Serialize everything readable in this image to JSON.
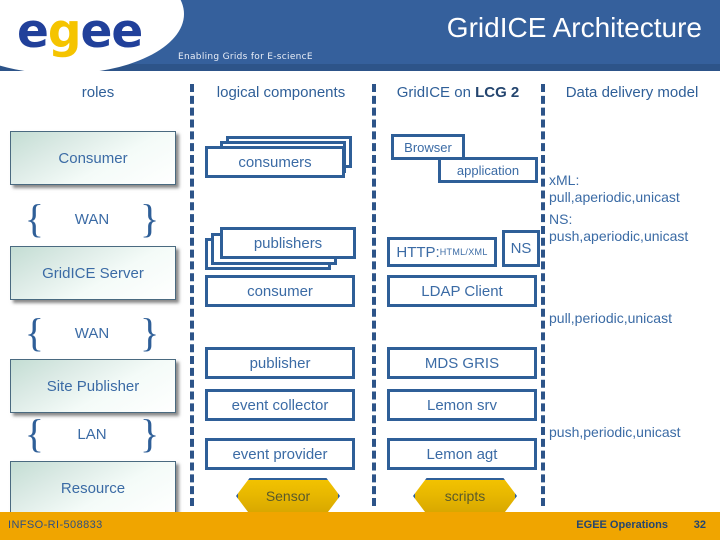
{
  "header": {
    "logo_text_1": "e",
    "logo_text_gold": "g",
    "logo_text_2": "ee",
    "tagline": "Enabling Grids for E-sciencE",
    "title": "GridICE Architecture",
    "band_color": "#35609c",
    "logo_blue": "#21409a",
    "logo_gold": "#f5c400"
  },
  "columns": [
    {
      "label": "roles"
    },
    {
      "label": "logical components"
    },
    {
      "label_prefix": "GridICE on ",
      "label_bold": "LCG 2"
    },
    {
      "label": "Data delivery model"
    }
  ],
  "roles": {
    "boxes": [
      {
        "label": "Consumer"
      },
      {
        "label": "GridICE Server"
      },
      {
        "label": "Site Publisher"
      },
      {
        "label": "Resource"
      }
    ],
    "braces": [
      {
        "label": "WAN"
      },
      {
        "label": "WAN"
      },
      {
        "label": "LAN"
      }
    ],
    "brace_open": "{",
    "brace_close": "}"
  },
  "logical_components": {
    "items": [
      {
        "label": "consumers",
        "stacked": true
      },
      {
        "label": "publishers",
        "stacked": true
      },
      {
        "label": "consumer",
        "stacked": false
      },
      {
        "label": "publisher",
        "stacked": false
      },
      {
        "label": "event collector",
        "stacked": false
      },
      {
        "label": "event provider",
        "stacked": false
      }
    ],
    "sensor": "Sensor"
  },
  "gridice_lcg2": {
    "browser": "Browser",
    "application": "application",
    "http_big": "HTTP:",
    "http_small": "HTML/XML",
    "ns": "NS",
    "ldap_client": "LDAP Client",
    "mds_gris": "MDS GRIS",
    "lemon_srv": "Lemon srv",
    "lemon_agt": "Lemon agt",
    "scripts": "scripts"
  },
  "data_delivery": {
    "block1_line1": "xML:",
    "block1_line2": "pull,aperiodic,unicast",
    "block1_line3": "NS:",
    "block1_line4": "push,aperiodic,unicast",
    "block2": "pull,periodic,unicast",
    "block3": "push,periodic,unicast"
  },
  "footer": {
    "left": "INFSO-RI-508833",
    "right": "EGEE Operations",
    "page": "32",
    "bar_color": "#f0a500"
  }
}
